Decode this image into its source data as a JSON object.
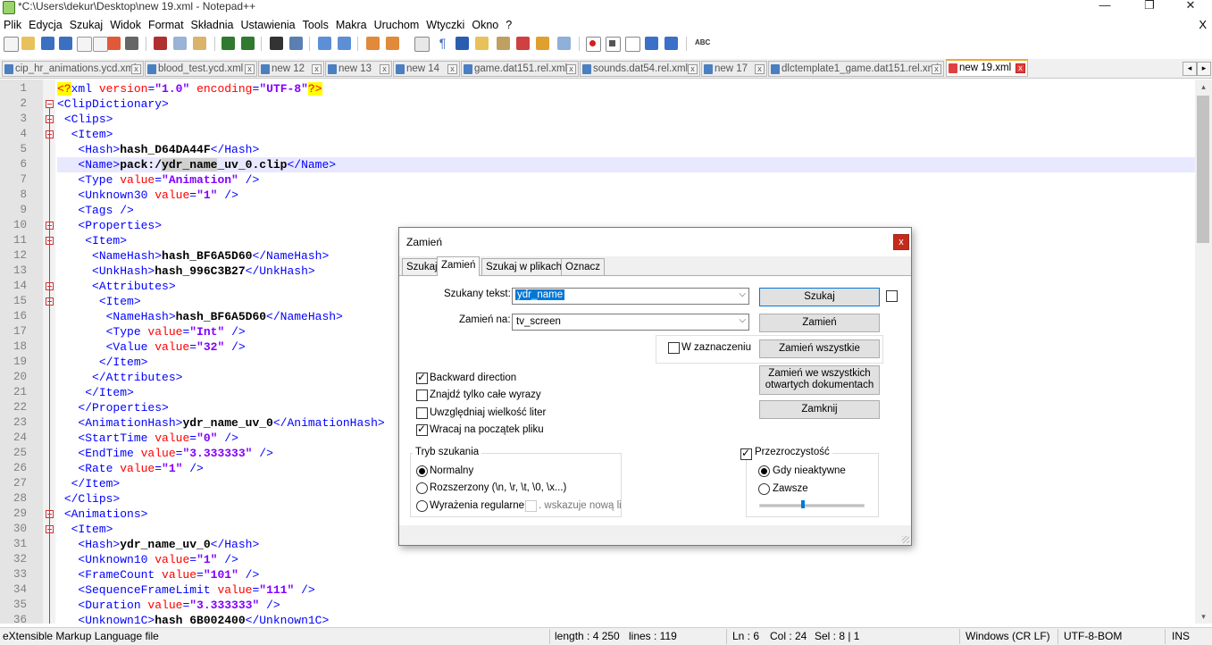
{
  "window": {
    "title": "*C:\\Users\\dekur\\Desktop\\new 19.xml - Notepad++",
    "minimize": "—",
    "maximize": "❐",
    "close": "✕"
  },
  "menu": [
    "Plik",
    "Edycja",
    "Szukaj",
    "Widok",
    "Format",
    "Składnia",
    "Ustawienia",
    "Tools",
    "Makra",
    "Uruchom",
    "Wtyczki",
    "Okno",
    "?"
  ],
  "menu_close": "X",
  "tabs": [
    {
      "label": "cip_hr_animations.ycd.xml",
      "active": false
    },
    {
      "label": "blood_test.ycd.xml",
      "active": false
    },
    {
      "label": "new 12",
      "active": false
    },
    {
      "label": "new 13",
      "active": false
    },
    {
      "label": "new 14",
      "active": false
    },
    {
      "label": "game.dat151.rel.xml",
      "active": false
    },
    {
      "label": "sounds.dat54.rel.xml",
      "active": false
    },
    {
      "label": "new 17",
      "active": false
    },
    {
      "label": "dlctemplate1_game.dat151.rel.xml",
      "active": false
    },
    {
      "label": "new 19.xml",
      "active": true
    }
  ],
  "tab_close": "x",
  "tab_scroll": [
    "◂",
    "▸"
  ],
  "scroll_arrows": [
    "▴",
    "▾"
  ],
  "editor": {
    "current_line": 6,
    "lines": [
      {
        "n": "1",
        "fold": "",
        "seg": [
          [
            "decl",
            "<?"
          ],
          [
            "tag",
            "xml "
          ],
          [
            "attr",
            "version"
          ],
          [
            "tag",
            "="
          ],
          [
            "val",
            "\"1.0\""
          ],
          [
            "tag",
            " "
          ],
          [
            "attr",
            "encoding"
          ],
          [
            "tag",
            "="
          ],
          [
            "val",
            "\"UTF-8\""
          ],
          [
            "decl",
            "?>"
          ]
        ]
      },
      {
        "n": "2",
        "fold": "box",
        "seg": [
          [
            "tag",
            "<ClipDictionary>"
          ]
        ]
      },
      {
        "n": "3",
        "fold": "box",
        "seg": [
          [
            "text",
            " "
          ],
          [
            "tag",
            "<Clips>"
          ]
        ]
      },
      {
        "n": "4",
        "fold": "box",
        "seg": [
          [
            "text",
            "  "
          ],
          [
            "tag",
            "<Item>"
          ]
        ]
      },
      {
        "n": "5",
        "fold": "",
        "seg": [
          [
            "text",
            "   "
          ],
          [
            "tag",
            "<Hash>"
          ],
          [
            "text",
            "hash_D64DA44F"
          ],
          [
            "tag",
            "</Hash>"
          ]
        ]
      },
      {
        "n": "6",
        "fold": "",
        "seg": [
          [
            "text",
            "   "
          ],
          [
            "tag",
            "<Name>"
          ],
          [
            "text",
            "pack:/"
          ],
          [
            "hl",
            "ydr_name"
          ],
          [
            "text",
            "_uv_0.clip"
          ],
          [
            "tag",
            "</Name>"
          ]
        ]
      },
      {
        "n": "7",
        "fold": "",
        "seg": [
          [
            "text",
            "   "
          ],
          [
            "tag",
            "<Type "
          ],
          [
            "attr",
            "value"
          ],
          [
            "tag",
            "="
          ],
          [
            "val",
            "\"Animation\""
          ],
          [
            "tag",
            " />"
          ]
        ]
      },
      {
        "n": "8",
        "fold": "",
        "seg": [
          [
            "text",
            "   "
          ],
          [
            "tag",
            "<Unknown30 "
          ],
          [
            "attr",
            "value"
          ],
          [
            "tag",
            "="
          ],
          [
            "val",
            "\"1\""
          ],
          [
            "tag",
            " />"
          ]
        ]
      },
      {
        "n": "9",
        "fold": "",
        "seg": [
          [
            "text",
            "   "
          ],
          [
            "tag",
            "<Tags />"
          ]
        ]
      },
      {
        "n": "10",
        "fold": "box",
        "seg": [
          [
            "text",
            "   "
          ],
          [
            "tag",
            "<Properties>"
          ]
        ]
      },
      {
        "n": "11",
        "fold": "box",
        "seg": [
          [
            "text",
            "    "
          ],
          [
            "tag",
            "<Item>"
          ]
        ]
      },
      {
        "n": "12",
        "fold": "",
        "seg": [
          [
            "text",
            "     "
          ],
          [
            "tag",
            "<NameHash>"
          ],
          [
            "text",
            "hash_BF6A5D60"
          ],
          [
            "tag",
            "</NameHash>"
          ]
        ]
      },
      {
        "n": "13",
        "fold": "",
        "seg": [
          [
            "text",
            "     "
          ],
          [
            "tag",
            "<UnkHash>"
          ],
          [
            "text",
            "hash_996C3B27"
          ],
          [
            "tag",
            "</UnkHash>"
          ]
        ]
      },
      {
        "n": "14",
        "fold": "box",
        "seg": [
          [
            "text",
            "     "
          ],
          [
            "tag",
            "<Attributes>"
          ]
        ]
      },
      {
        "n": "15",
        "fold": "box",
        "seg": [
          [
            "text",
            "      "
          ],
          [
            "tag",
            "<Item>"
          ]
        ]
      },
      {
        "n": "16",
        "fold": "",
        "seg": [
          [
            "text",
            "       "
          ],
          [
            "tag",
            "<NameHash>"
          ],
          [
            "text",
            "hash_BF6A5D60"
          ],
          [
            "tag",
            "</NameHash>"
          ]
        ]
      },
      {
        "n": "17",
        "fold": "",
        "seg": [
          [
            "text",
            "       "
          ],
          [
            "tag",
            "<Type "
          ],
          [
            "attr",
            "value"
          ],
          [
            "tag",
            "="
          ],
          [
            "val",
            "\"Int\""
          ],
          [
            "tag",
            " />"
          ]
        ]
      },
      {
        "n": "18",
        "fold": "",
        "seg": [
          [
            "text",
            "       "
          ],
          [
            "tag",
            "<Value "
          ],
          [
            "attr",
            "value"
          ],
          [
            "tag",
            "="
          ],
          [
            "val",
            "\"32\""
          ],
          [
            "tag",
            " />"
          ]
        ]
      },
      {
        "n": "19",
        "fold": "end",
        "seg": [
          [
            "text",
            "      "
          ],
          [
            "tag",
            "</Item>"
          ]
        ]
      },
      {
        "n": "20",
        "fold": "end",
        "seg": [
          [
            "text",
            "     "
          ],
          [
            "tag",
            "</Attributes>"
          ]
        ]
      },
      {
        "n": "21",
        "fold": "end",
        "seg": [
          [
            "text",
            "    "
          ],
          [
            "tag",
            "</Item>"
          ]
        ]
      },
      {
        "n": "22",
        "fold": "end",
        "seg": [
          [
            "text",
            "   "
          ],
          [
            "tag",
            "</Properties>"
          ]
        ]
      },
      {
        "n": "23",
        "fold": "",
        "seg": [
          [
            "text",
            "   "
          ],
          [
            "tag",
            "<AnimationHash>"
          ],
          [
            "text",
            "ydr_name_uv_0"
          ],
          [
            "tag",
            "</AnimationHash>"
          ]
        ]
      },
      {
        "n": "24",
        "fold": "",
        "seg": [
          [
            "text",
            "   "
          ],
          [
            "tag",
            "<StartTime "
          ],
          [
            "attr",
            "value"
          ],
          [
            "tag",
            "="
          ],
          [
            "val",
            "\"0\""
          ],
          [
            "tag",
            " />"
          ]
        ]
      },
      {
        "n": "25",
        "fold": "",
        "seg": [
          [
            "text",
            "   "
          ],
          [
            "tag",
            "<EndTime "
          ],
          [
            "attr",
            "value"
          ],
          [
            "tag",
            "="
          ],
          [
            "val",
            "\"3.333333\""
          ],
          [
            "tag",
            " />"
          ]
        ]
      },
      {
        "n": "26",
        "fold": "",
        "seg": [
          [
            "text",
            "   "
          ],
          [
            "tag",
            "<Rate "
          ],
          [
            "attr",
            "value"
          ],
          [
            "tag",
            "="
          ],
          [
            "val",
            "\"1\""
          ],
          [
            "tag",
            " />"
          ]
        ]
      },
      {
        "n": "27",
        "fold": "end",
        "seg": [
          [
            "text",
            "  "
          ],
          [
            "tag",
            "</Item>"
          ]
        ]
      },
      {
        "n": "28",
        "fold": "end",
        "seg": [
          [
            "text",
            " "
          ],
          [
            "tag",
            "</Clips>"
          ]
        ]
      },
      {
        "n": "29",
        "fold": "box",
        "seg": [
          [
            "text",
            " "
          ],
          [
            "tag",
            "<Animations>"
          ]
        ]
      },
      {
        "n": "30",
        "fold": "box",
        "seg": [
          [
            "text",
            "  "
          ],
          [
            "tag",
            "<Item>"
          ]
        ]
      },
      {
        "n": "31",
        "fold": "",
        "seg": [
          [
            "text",
            "   "
          ],
          [
            "tag",
            "<Hash>"
          ],
          [
            "text",
            "ydr_name_uv_0"
          ],
          [
            "tag",
            "</Hash>"
          ]
        ]
      },
      {
        "n": "32",
        "fold": "",
        "seg": [
          [
            "text",
            "   "
          ],
          [
            "tag",
            "<Unknown10 "
          ],
          [
            "attr",
            "value"
          ],
          [
            "tag",
            "="
          ],
          [
            "val",
            "\"1\""
          ],
          [
            "tag",
            " />"
          ]
        ]
      },
      {
        "n": "33",
        "fold": "",
        "seg": [
          [
            "text",
            "   "
          ],
          [
            "tag",
            "<FrameCount "
          ],
          [
            "attr",
            "value"
          ],
          [
            "tag",
            "="
          ],
          [
            "val",
            "\"101\""
          ],
          [
            "tag",
            " />"
          ]
        ]
      },
      {
        "n": "34",
        "fold": "",
        "seg": [
          [
            "text",
            "   "
          ],
          [
            "tag",
            "<SequenceFrameLimit "
          ],
          [
            "attr",
            "value"
          ],
          [
            "tag",
            "="
          ],
          [
            "val",
            "\"111\""
          ],
          [
            "tag",
            " />"
          ]
        ]
      },
      {
        "n": "35",
        "fold": "",
        "seg": [
          [
            "text",
            "   "
          ],
          [
            "tag",
            "<Duration "
          ],
          [
            "attr",
            "value"
          ],
          [
            "tag",
            "="
          ],
          [
            "val",
            "\"3.333333\""
          ],
          [
            "tag",
            " />"
          ]
        ]
      },
      {
        "n": "36",
        "fold": "",
        "seg": [
          [
            "text",
            "   "
          ],
          [
            "tag",
            "<Unknown1C>"
          ],
          [
            "text",
            "hash_6B002400"
          ],
          [
            "tag",
            "</Unknown1C>"
          ]
        ]
      }
    ]
  },
  "status": {
    "filetype": "eXtensible Markup Language file",
    "length": "length : 4 250",
    "lines": "lines : 119",
    "ln": "Ln : 6",
    "col": "Col : 24",
    "sel": "Sel : 8 | 1",
    "eol": "Windows (CR LF)",
    "encoding": "UTF-8-BOM",
    "ins": "INS"
  },
  "dialog": {
    "title": "Zamień",
    "close": "x",
    "tabs": [
      "Szukaj",
      "Zamień",
      "Szukaj w plikach",
      "Oznacz"
    ],
    "active_tab": "Zamień",
    "find_label": "Szukany tekst:",
    "find_value": "ydr_name",
    "replace_label": "Zamień na:",
    "replace_value": "tv_screen",
    "in_selection": "W zaznaczeniu",
    "buttons": {
      "find": "Szukaj",
      "replace": "Zamień",
      "replace_all": "Zamień wszystkie",
      "replace_all_docs_1": "Zamień we wszystkich",
      "replace_all_docs_2": "otwartych dokumentach",
      "close": "Zamknij"
    },
    "options": [
      {
        "label": "Backward direction",
        "checked": true
      },
      {
        "label": "Znajdź tylko całe wyrazy",
        "checked": false
      },
      {
        "label": "Uwzględniaj wielkość liter",
        "checked": false
      },
      {
        "label": "Wracaj na początek pliku",
        "checked": true
      }
    ],
    "search_mode": {
      "title": "Tryb szukania",
      "normal": "Normalny",
      "extended": "Rozszerzony (\\n, \\r, \\t, \\0, \\x...)",
      "regex": "Wyrażenia regularne",
      "dot_newline": ". wskazuje nową li",
      "selected": "normal"
    },
    "transparency": {
      "title": "Przezroczystość",
      "enabled": true,
      "on_losing_focus": "Gdy nieaktywne",
      "always": "Zawsze",
      "selected": "on_losing_focus",
      "level": 0.42
    }
  }
}
